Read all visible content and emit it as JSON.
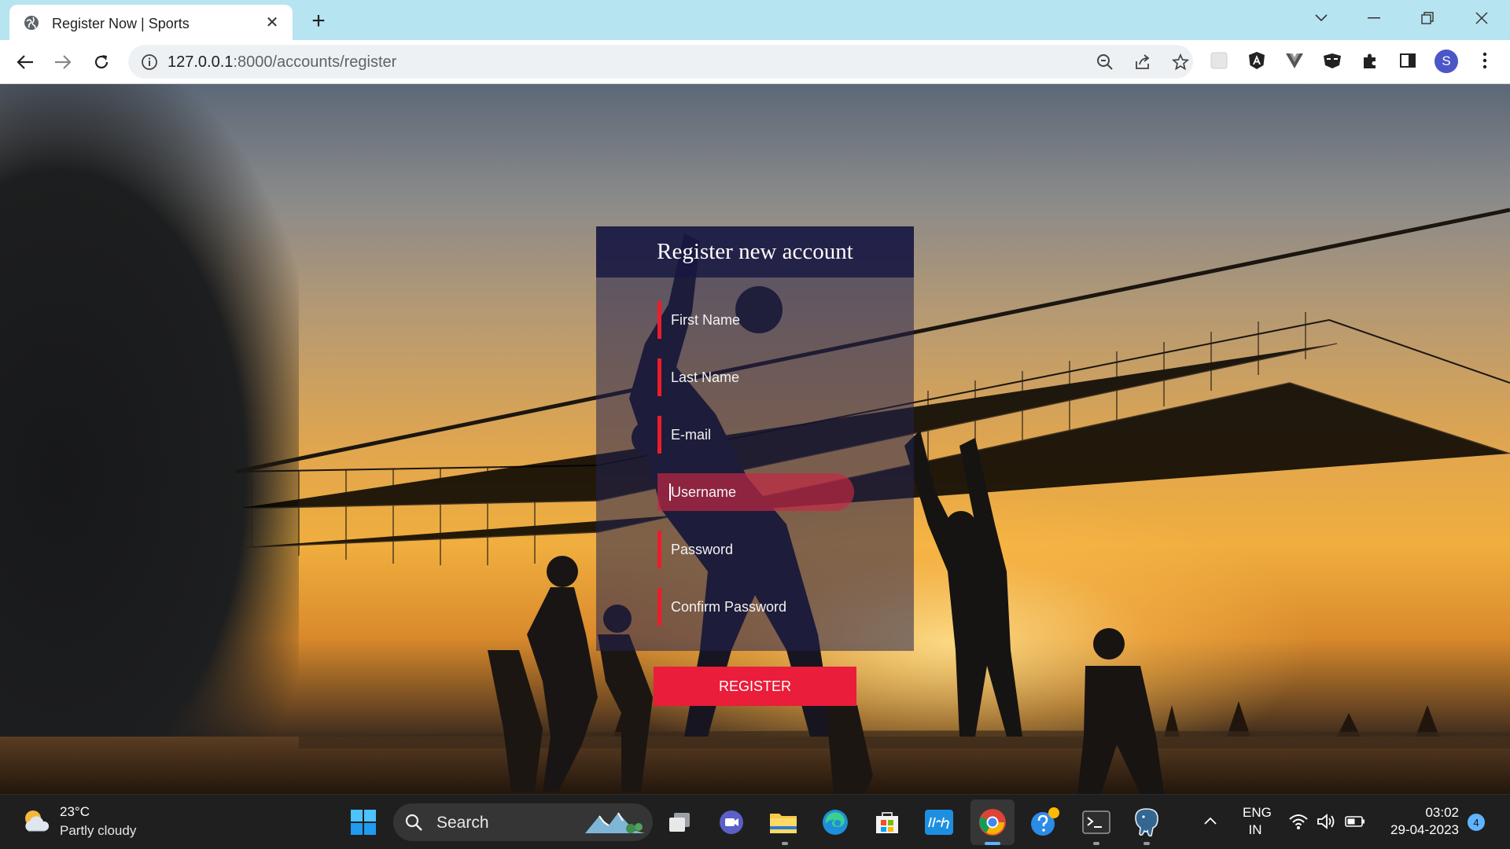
{
  "browser": {
    "tab": {
      "title": "Register Now | Sports"
    },
    "omnibox": {
      "host": "127.0.0.1",
      "path": ":8000/accounts/register"
    },
    "profile_initial": "S"
  },
  "page": {
    "form": {
      "title": "Register new account",
      "fields": [
        {
          "label": "First Name"
        },
        {
          "label": "Last Name"
        },
        {
          "label": "E-mail"
        },
        {
          "label": "Username",
          "focused": true
        },
        {
          "label": "Password"
        },
        {
          "label": "Confirm Password"
        }
      ],
      "submit_label": "REGISTER"
    },
    "colors": {
      "accent": "#ea1d3a",
      "header": "#181842",
      "field_bar": "#ee1c2a"
    }
  },
  "taskbar": {
    "weather": {
      "temp": "23°C",
      "desc": "Partly cloudy"
    },
    "search_label": "Search",
    "apps": [
      "windows-start",
      "task-view",
      "teams-meet",
      "file-explorer",
      "edge",
      "microsoft-store",
      "myhp",
      "chrome",
      "get-help",
      "terminal",
      "postgresql"
    ],
    "lang_line1": "ENG",
    "lang_line2": "IN",
    "time": "03:02",
    "date": "29-04-2023",
    "notification_count": "4"
  }
}
